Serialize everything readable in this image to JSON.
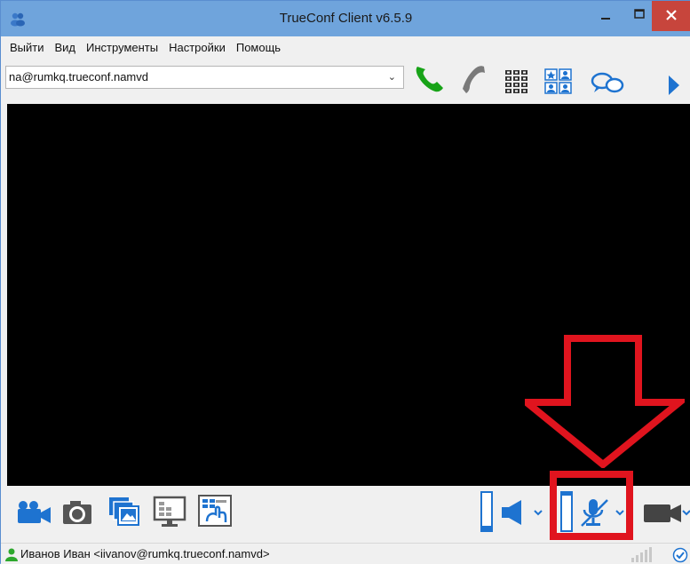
{
  "window": {
    "title": "TrueConf Client v6.5.9"
  },
  "menu": [
    "Выйти",
    "Вид",
    "Инструменты",
    "Настройки",
    "Помощь"
  ],
  "toolbar": {
    "address_value": "na@rumkq.trueconf.namvd",
    "icons": [
      "call-icon",
      "hangup-icon",
      "dialpad-icon",
      "contacts-icon",
      "chat-icon",
      "expand-panel-icon"
    ]
  },
  "bottombar": {
    "icons": [
      "camera-icon",
      "snapshot-icon",
      "slideshow-icon",
      "screen-share-icon",
      "remote-desktop-icon",
      "speaker-icon",
      "microphone-muted-icon",
      "video-icon"
    ]
  },
  "status": {
    "user_text": "Иванов Иван <iivanov@rumkq.trueconf.namvd>"
  },
  "colors": {
    "titlebar": "#6fa4dc",
    "close_button": "#c7453c",
    "annotation": "#e0141e",
    "icon_blue": "#1e73d0",
    "call_green": "#18a318"
  }
}
